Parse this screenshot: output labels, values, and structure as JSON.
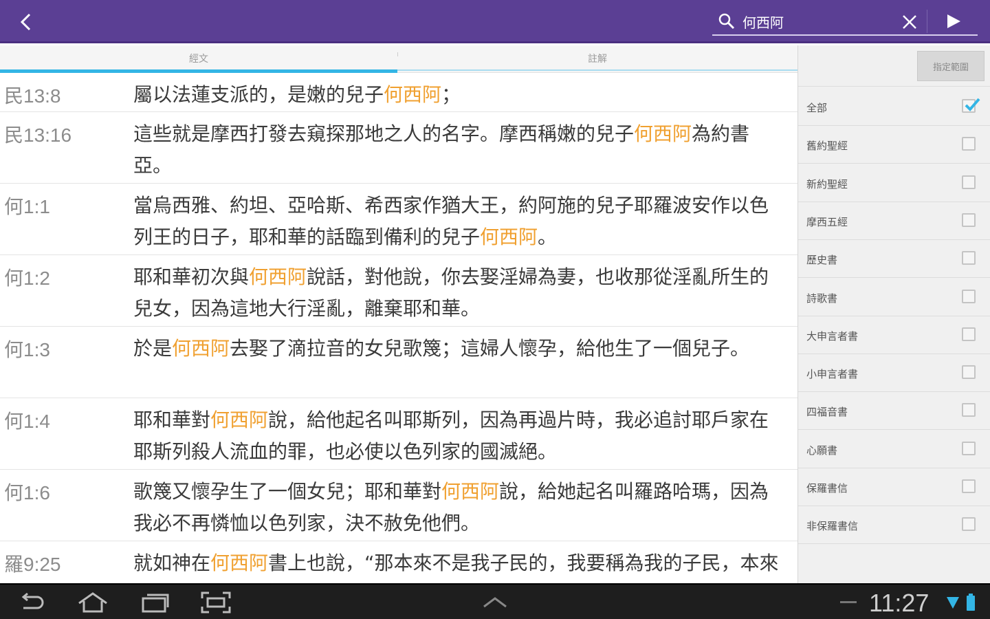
{
  "search": {
    "query": "何西阿"
  },
  "tabs": [
    {
      "label": "經文",
      "active": true
    },
    {
      "label": "註解",
      "active": false
    }
  ],
  "verses": [
    {
      "ref": "民13:8",
      "pre": "屬以法蓮支派的，是嫩的兒子",
      "hl": "何西阿",
      "post": "；",
      "lines": 1
    },
    {
      "ref": "民13:16",
      "pre": "這些就是摩西打發去窺探那地之人的名字。摩西稱嫩的兒子",
      "hl": "何西阿",
      "post": "為約書亞。",
      "lines": 2
    },
    {
      "ref": "何1:1",
      "pre": "當烏西雅、約坦、亞哈斯、希西家作猶大王，約阿施的兒子耶羅波安作以色列王的日子，耶和華的話臨到備利的兒子",
      "hl": "何西阿",
      "post": "。",
      "lines": 2
    },
    {
      "ref": "何1:2",
      "pre": "耶和華初次與",
      "hl": "何西阿",
      "post": "說話，對他說，你去娶淫婦為妻，也收那從淫亂所生的兒女，因為這地大行淫亂，離棄耶和華。",
      "lines": 2
    },
    {
      "ref": "何1:3",
      "pre": "於是",
      "hl": "何西阿",
      "post": "去娶了滴拉音的女兒歌篾；這婦人懷孕，給他生了一個兒子。",
      "lines": 2
    },
    {
      "ref": "何1:4",
      "pre": "耶和華對",
      "hl": "何西阿",
      "post": "說，給他起名叫耶斯列，因為再過片時，我必追討耶戶家在耶斯列殺人流血的罪，也必使以色列家的國滅絕。",
      "lines": 2
    },
    {
      "ref": "何1:6",
      "pre": "歌篾又懷孕生了一個女兒；耶和華對",
      "hl": "何西阿",
      "post": "說，給她起名叫羅路哈瑪，因為我必不再憐恤以色列家，決不赦免他們。",
      "lines": 2
    },
    {
      "ref": "羅9:25",
      "pre": "就如神在",
      "hl": "何西阿",
      "post": "書上也說，“那本來不是我子民的，我要稱為我的子民，本來不是蒙愛的，我要稱為蒙愛的。",
      "lines": 2
    }
  ],
  "filter": {
    "range_button": "指定範圍",
    "options": [
      {
        "label": "全部",
        "checked": true
      },
      {
        "label": "舊約聖經",
        "checked": false
      },
      {
        "label": "新約聖經",
        "checked": false
      },
      {
        "label": "摩西五經",
        "checked": false
      },
      {
        "label": "歷史書",
        "checked": false
      },
      {
        "label": "詩歌書",
        "checked": false
      },
      {
        "label": "大申言者書",
        "checked": false
      },
      {
        "label": "小申言者書",
        "checked": false
      },
      {
        "label": "四福音書",
        "checked": false
      },
      {
        "label": "心願書",
        "checked": false
      },
      {
        "label": "保羅書信",
        "checked": false
      },
      {
        "label": "非保羅書信",
        "checked": false
      }
    ]
  },
  "status": {
    "time": "11:27"
  },
  "colors": {
    "accent": "#5b3f94",
    "highlight": "#f0a030",
    "tab_indicator": "#33b5e5"
  }
}
